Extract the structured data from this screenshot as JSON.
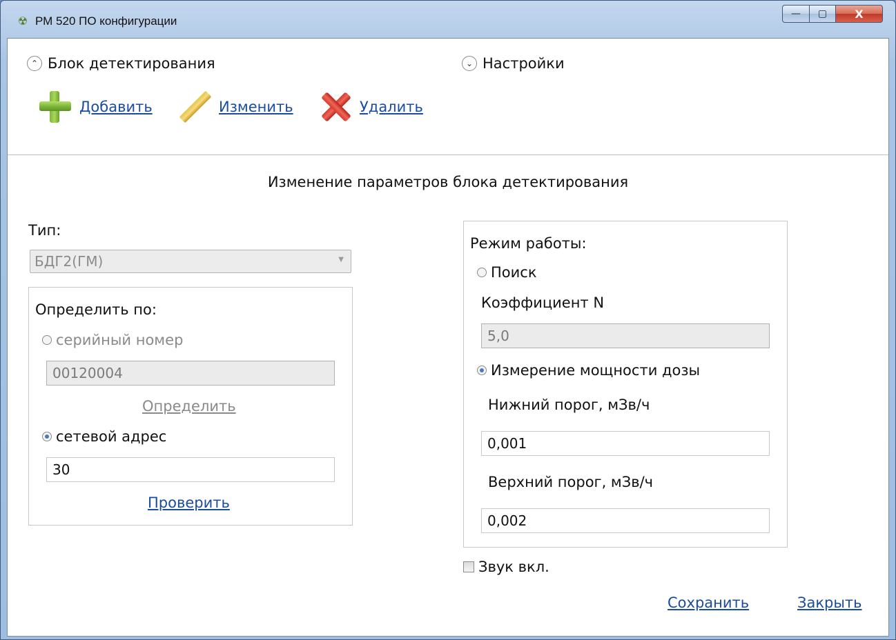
{
  "window": {
    "title": "РМ 520 ПО конфигурации",
    "icon": "radiation-app-icon",
    "controls": {
      "minimize": "—",
      "maximize": "▢",
      "close": "X"
    }
  },
  "top": {
    "expander_left": {
      "label": "Блок детектирования",
      "state": "expanded"
    },
    "expander_right": {
      "label": "Настройки",
      "state": "collapsed"
    },
    "toolbar": {
      "add_label": "Добавить",
      "edit_label": "Изменить",
      "delete_label": "Удалить"
    }
  },
  "form": {
    "title": "Изменение параметров блока детектирования",
    "type_label": "Тип:",
    "type_value": "БДГ2(ГМ)",
    "identify": {
      "label": "Определить по:",
      "serial_label": "серийный номер",
      "serial_value": "00120004",
      "determine_link": "Определить",
      "address_label": "сетевой адрес",
      "address_value": "30",
      "check_link": "Проверить",
      "selected": "address"
    },
    "mode": {
      "label": "Режим работы:",
      "search_label": "Поиск",
      "coef_label": "Коэффициент N",
      "coef_value": "5,0",
      "dose_label": "Измерение мощности дозы",
      "lower_label": "Нижний порог, мЗв/ч",
      "lower_value": "0,001",
      "upper_label": "Верхний порог, мЗв/ч",
      "upper_value": "0,002",
      "selected": "dose"
    },
    "sound_label": "Звук вкл.",
    "sound_checked": false,
    "save_link": "Сохранить",
    "close_link": "Закрыть"
  },
  "colors": {
    "link": "#1a4c9e",
    "disabled_text": "#8a8a8a",
    "radio_selected": "#4a7ab8"
  }
}
